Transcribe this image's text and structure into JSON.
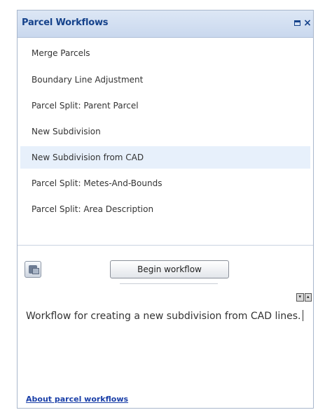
{
  "panel": {
    "title": "Parcel Workflows",
    "close_glyph": "×",
    "float_icon": "float-window-icon",
    "close_icon": "close-icon"
  },
  "workflows": [
    {
      "label": "Merge Parcels"
    },
    {
      "label": "Boundary Line Adjustment"
    },
    {
      "label": "Parcel Split: Parent Parcel"
    },
    {
      "label": "New Subdivision"
    },
    {
      "label": "New Subdivision from CAD",
      "selected": true
    },
    {
      "label": "Parcel Split: Metes-And-Bounds"
    },
    {
      "label": "Parcel Split: Area Description"
    }
  ],
  "actions": {
    "begin_label": "Begin workflow",
    "help_icon": "options-icon",
    "toggle_icon": "toggle-description-icon"
  },
  "description": {
    "text": "Workflow for creating a new subdivision from CAD lines."
  },
  "footer": {
    "about_link": "About parcel workflows"
  },
  "colors": {
    "title_text": "#15428b",
    "selected_row": "#e7f0fb",
    "link": "#1a3fa8"
  }
}
